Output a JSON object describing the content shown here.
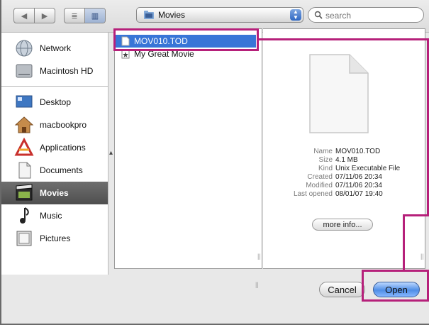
{
  "toolbar": {
    "back_glyph": "◀",
    "forward_glyph": "▶",
    "list_view_glyph": "≣",
    "column_view_glyph": "▥",
    "location": "Movies",
    "search_placeholder": "search"
  },
  "sidebar": {
    "items": [
      {
        "label": "Network",
        "icon": "network-globe-icon"
      },
      {
        "label": "Macintosh HD",
        "icon": "hard-drive-icon"
      },
      {
        "label": "Desktop",
        "icon": "desktop-icon"
      },
      {
        "label": "macbookpro",
        "icon": "home-icon"
      },
      {
        "label": "Applications",
        "icon": "applications-icon"
      },
      {
        "label": "Documents",
        "icon": "documents-icon"
      },
      {
        "label": "Movies",
        "icon": "movies-icon",
        "selected": true
      },
      {
        "label": "Music",
        "icon": "music-icon"
      },
      {
        "label": "Pictures",
        "icon": "pictures-icon"
      }
    ]
  },
  "files": [
    {
      "name": "MOV010.TOD",
      "selected": true
    },
    {
      "name": "My Great Movie",
      "selected": false
    }
  ],
  "preview": {
    "fields": [
      {
        "key": "Name",
        "value": "MOV010.TOD"
      },
      {
        "key": "Size",
        "value": "4.1 MB"
      },
      {
        "key": "Kind",
        "value": "Unix Executable File"
      },
      {
        "key": "Created",
        "value": "07/11/06 20:34"
      },
      {
        "key": "Modified",
        "value": "07/11/06 20:34"
      },
      {
        "key": "Last opened",
        "value": "08/01/07 19:40"
      }
    ],
    "more_info_label": "more info..."
  },
  "buttons": {
    "cancel": "Cancel",
    "open": "Open"
  },
  "colors": {
    "highlight": "#b6207a",
    "selection": "#3875d7"
  }
}
